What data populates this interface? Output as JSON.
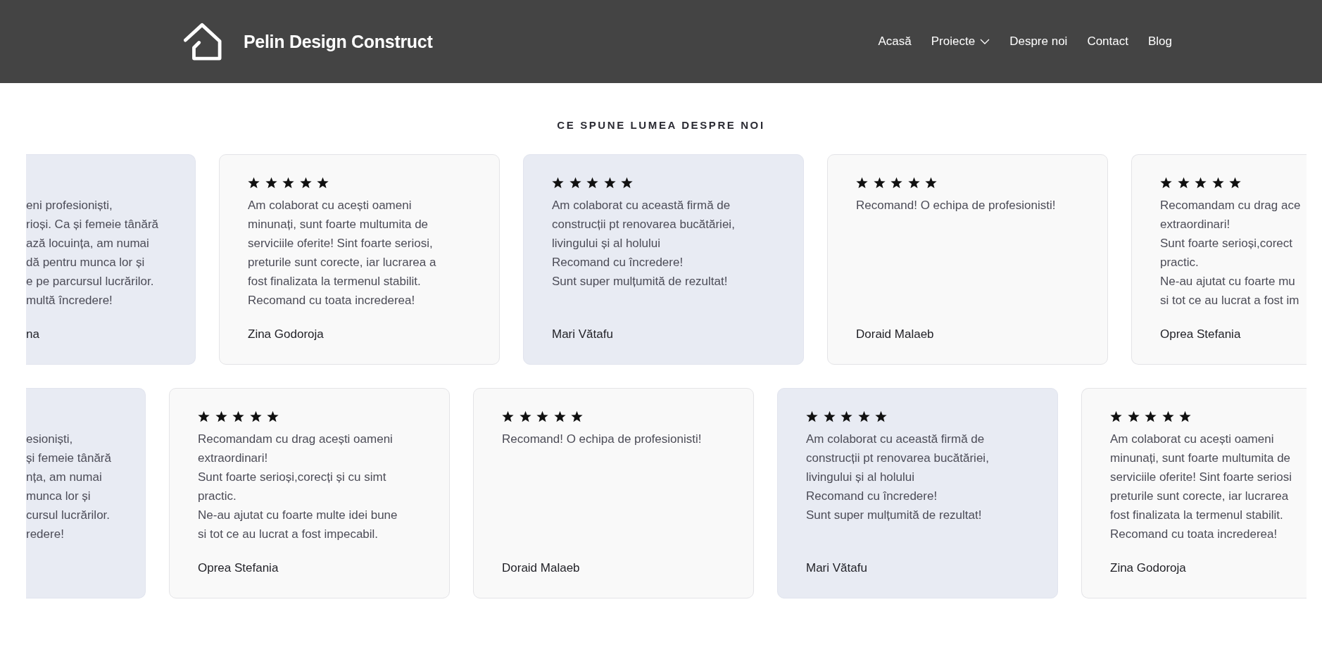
{
  "header": {
    "title": "Pelin Design Construct",
    "nav": [
      {
        "label": "Acasă",
        "dropdown": false
      },
      {
        "label": "Proiecte",
        "dropdown": true
      },
      {
        "label": "Despre noi",
        "dropdown": false
      },
      {
        "label": "Contact",
        "dropdown": false
      },
      {
        "label": "Blog",
        "dropdown": false
      }
    ]
  },
  "section_title": "CE SPUNE LUMEA DESPRE NOI",
  "rows": [
    {
      "cards": [
        {
          "kind": "cut-left",
          "tinted": true,
          "lines": [
            "eni profesioniști,",
            "rioși. Ca și femeie tânără",
            "ază locuința, am numai",
            "dă pentru munca lor și",
            "e pe parcursul lucrărilor.",
            "multă încredere!"
          ],
          "name": "na"
        },
        {
          "kind": "full",
          "tinted": false,
          "stars": 5,
          "lines": [
            "Am colaborat cu acești oameni",
            "minunați, sunt foarte multumita de",
            "serviciile oferite! Sint foarte seriosi,",
            "preturile sunt corecte, iar lucrarea a",
            "fost finalizata la termenul stabilit.",
            "Recomand cu toata increderea!"
          ],
          "name": "Zina Godoroja"
        },
        {
          "kind": "full",
          "tinted": true,
          "stars": 5,
          "lines": [
            "Am colaborat cu această firmă de",
            "construcții pt renovarea bucătăriei,",
            "livingului și al holului",
            "Recomand cu încredere!",
            "Sunt super mulțumită de rezultat!"
          ],
          "name": "Mari Vătafu"
        },
        {
          "kind": "full",
          "tinted": false,
          "stars": 5,
          "lines": [
            "Recomand! O echipa de profesionisti!"
          ],
          "name": "Doraid Malaeb"
        },
        {
          "kind": "cut-right",
          "tinted": false,
          "stars": 5,
          "lines": [
            "Recomandam cu drag ace",
            "extraordinari!",
            "Sunt foarte serioși,corect",
            "practic.",
            "Ne-au ajutat cu foarte mu",
            "si tot ce au lucrat a fost im"
          ],
          "name": "Oprea Stefania"
        }
      ]
    },
    {
      "cards": [
        {
          "kind": "cut-left",
          "tinted": true,
          "lines": [
            "esioniști,",
            "și femeie tânără",
            "nța, am numai",
            "munca lor și",
            "cursul lucrărilor.",
            "redere!"
          ]
        },
        {
          "kind": "full",
          "tinted": false,
          "stars": 5,
          "lines": [
            "Recomandam cu drag acești oameni",
            "extraordinari!",
            "Sunt foarte serioși,corecți și cu simt",
            "practic.",
            "Ne-au ajutat cu foarte multe idei bune",
            "si tot ce au lucrat a fost impecabil."
          ],
          "name": "Oprea Stefania"
        },
        {
          "kind": "full",
          "tinted": false,
          "stars": 5,
          "lines": [
            "Recomand! O echipa de profesionisti!"
          ],
          "name": "Doraid Malaeb"
        },
        {
          "kind": "full",
          "tinted": true,
          "stars": 5,
          "lines": [
            "Am colaborat cu această firmă de",
            "construcții pt renovarea bucătăriei,",
            "livingului și al holului",
            "Recomand cu încredere!",
            "Sunt super mulțumită de rezultat!"
          ],
          "name": "Mari Vătafu"
        },
        {
          "kind": "cut-right",
          "tinted": false,
          "stars": 5,
          "lines": [
            "Am colaborat cu acești oameni",
            "minunați, sunt foarte multumita de",
            "serviciile oferite! Sint foarte seriosi",
            "preturile sunt corecte, iar lucrarea",
            "fost finalizata la termenul stabilit.",
            "Recomand cu toata increderea!"
          ],
          "name": "Zina Godoroja"
        }
      ]
    }
  ]
}
